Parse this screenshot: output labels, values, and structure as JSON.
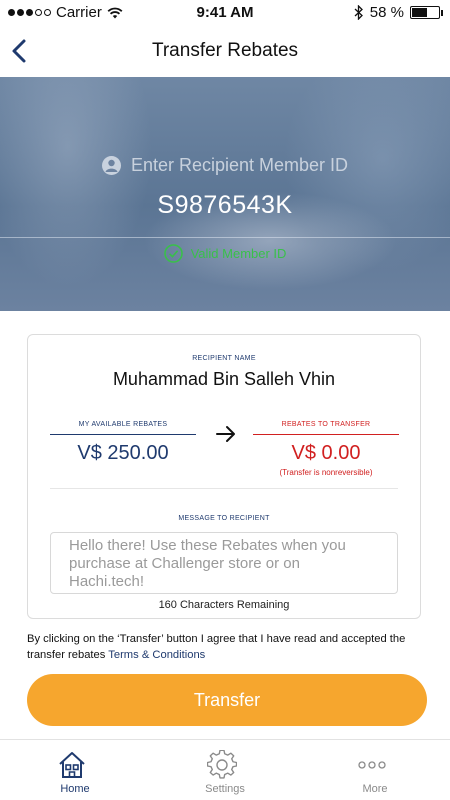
{
  "status_bar": {
    "carrier": "Carrier",
    "time": "9:41 AM",
    "battery": "58 %",
    "battery_level": 0.58
  },
  "nav": {
    "title": "Transfer Rebates",
    "back_icon": "chevron-left-icon"
  },
  "hero": {
    "placeholder": "Enter Recipient Member ID",
    "member_id": "S9876543K",
    "valid_text": "Valid Member ID"
  },
  "card": {
    "recipient_label": "RECIPIENT NAME",
    "recipient_name": "Muhammad Bin Salleh Vhin",
    "available_label": "MY AVAILABLE REBATES",
    "available_value": "V$ 250.00",
    "transfer_label": "REBATES TO TRANSFER",
    "transfer_value": "V$ 0.00",
    "transfer_note": "(Transfer is nonreversible)",
    "message_label": "MESSAGE TO RECIPIENT",
    "message_placeholder": "Hello there! Use these Rebates when you purchase at Challenger store or on Hachi.tech!",
    "chars_remaining": "160 Characters Remaining"
  },
  "agreement": {
    "text": "By clicking on the ‘Transfer’ button I agree that I have read and accepted the transfer rebates ",
    "link": "Terms & Conditions"
  },
  "transfer_button": "Transfer",
  "tabs": [
    {
      "label": "Home",
      "icon": "home-icon",
      "active": true
    },
    {
      "label": "Settings",
      "icon": "gear-icon",
      "active": false
    },
    {
      "label": "More",
      "icon": "more-dots-icon",
      "active": false
    }
  ],
  "colors": {
    "brand_navy": "#1f3a6e",
    "alert_red": "#d12020",
    "accent_orange": "#f6a62e",
    "valid_green": "#39c04a"
  }
}
